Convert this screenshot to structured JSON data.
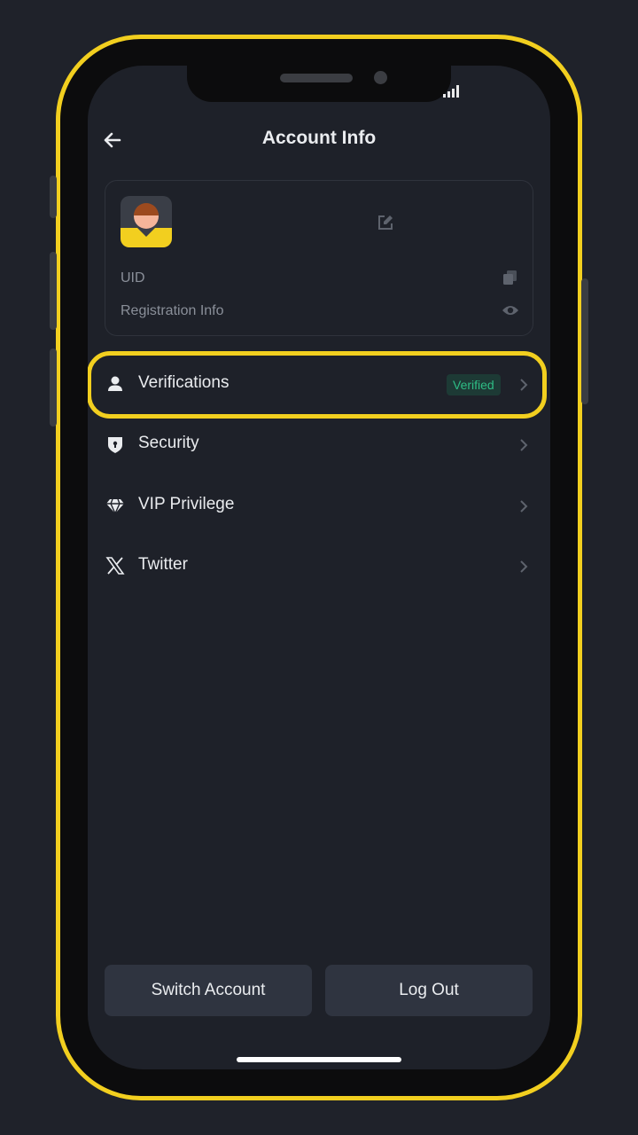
{
  "header": {
    "title": "Account Info"
  },
  "profile_card": {
    "uid_label": "UID",
    "registration_label": "Registration Info"
  },
  "menu": {
    "items": [
      {
        "label": "Verifications",
        "icon": "person-icon",
        "badge": "Verified"
      },
      {
        "label": "Security",
        "icon": "shield-icon"
      },
      {
        "label": "VIP Privilege",
        "icon": "diamond-icon"
      },
      {
        "label": "Twitter",
        "icon": "x-logo-icon"
      }
    ]
  },
  "footer": {
    "switch_account": "Switch Account",
    "log_out": "Log Out"
  },
  "colors": {
    "background": "#1e2129",
    "accent_highlight": "#f2cf1f",
    "verified_text": "#2ebd85",
    "button_bg": "#2f3440"
  }
}
